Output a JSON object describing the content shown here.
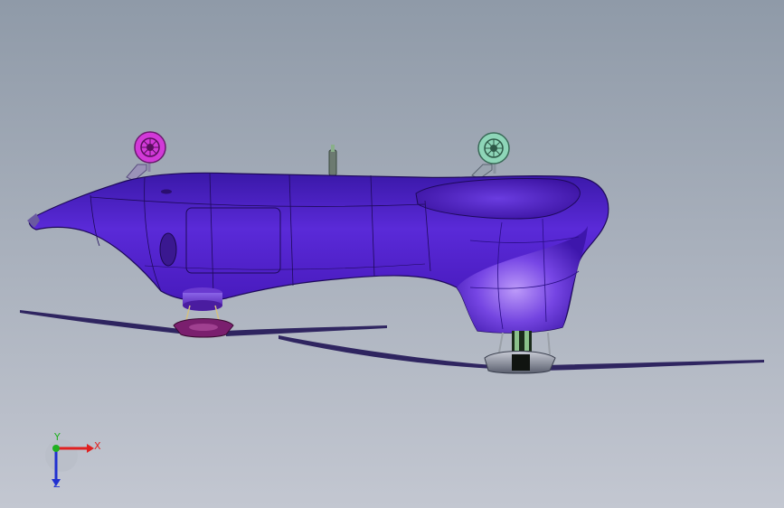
{
  "viewport": {
    "background_top": "#8f9aa8",
    "background_bottom": "#c3c7d1"
  },
  "model": {
    "body_color": "#4d1fc8",
    "body_highlight": "#8a5cf0",
    "body_shadow": "#2a0e86",
    "wheel_left_color": "#d239d8",
    "wheel_right_color": "#8ed6b8",
    "motor_front_color": "#7a1f6e",
    "motor_rear_color": "#6d7380",
    "propeller_color": "#3a2b6a"
  },
  "triad": {
    "x_label": "X",
    "y_label": "Y",
    "z_label": "Z",
    "x_color": "#e02020",
    "y_color": "#1fb020",
    "z_color": "#2030d0"
  }
}
